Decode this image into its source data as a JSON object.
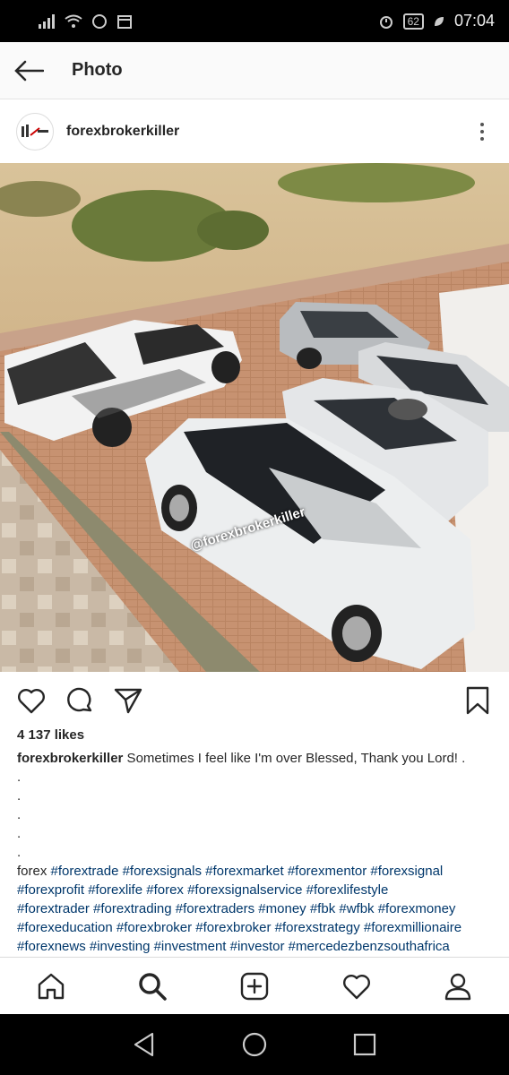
{
  "status_bar": {
    "battery": "62",
    "time": "07:04"
  },
  "app_bar": {
    "title": "Photo"
  },
  "post": {
    "username": "forexbrokerkiller",
    "watermark": "@forexbrokerkiller",
    "likes": "4 137 likes",
    "caption_user": "forexbrokerkiller",
    "caption_text": " Sometimes I feel like I'm over Blessed, Thank you Lord! .",
    "dots": [
      ".",
      ".",
      ".",
      ".",
      "."
    ],
    "hashtag_first": "forex",
    "hashtag_line1": " #forextrade #forexsignals #forexmarket #forexmentor #forexsignal",
    "hashtag_line2": "#forexprofit #forexlife #forex #forexsignalservice #forexlifestyle",
    "hashtag_line3": "#forextrader #forextrading #forextraders #money #fbk #wfbk #forexmoney",
    "hashtag_line4": "#forexeducation #forexbroker #forexbroker #forexstrategy #forexmillionaire",
    "hashtag_line5": "#forexnews #investing #investment #investor #mercedezbenzsouthafrica"
  },
  "icons": {
    "back": "arrow-left-icon",
    "more": "more-vertical-icon",
    "like": "heart-icon",
    "comment": "comment-icon",
    "share": "send-icon",
    "save": "bookmark-icon",
    "home": "home-icon",
    "search": "search-icon",
    "add": "add-post-icon",
    "activity": "heart-icon",
    "profile": "profile-icon"
  }
}
